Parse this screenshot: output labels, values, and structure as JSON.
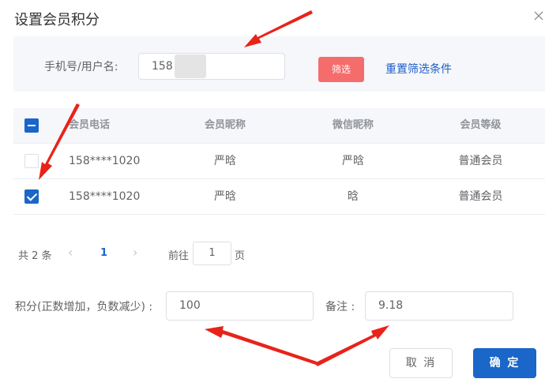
{
  "dialog": {
    "title": "设置会员积分",
    "close_icon": "close-icon"
  },
  "filter": {
    "label": "手机号/用户名:",
    "input_value": "158      1020",
    "filter_button": "筛选",
    "reset_link": "重置筛选条件"
  },
  "table": {
    "headers": [
      "会员电话",
      "会员昵称",
      "微信昵称",
      "会员等级"
    ],
    "rows": [
      {
        "checked": false,
        "phone": "158****1020",
        "nickname": "严晗",
        "wechat": "严晗",
        "level": "普通会员"
      },
      {
        "checked": true,
        "phone": "158****1020",
        "nickname": "严晗",
        "wechat": "晗",
        "level": "普通会员"
      }
    ]
  },
  "pagination": {
    "total": "共 2 条",
    "prev_icon": "chevron-left-icon",
    "current_page": "1",
    "next_icon": "chevron-right-icon",
    "goto_label": "前往",
    "goto_value": "1",
    "goto_unit": "页"
  },
  "form": {
    "points_label": "积分(正数增加，负数减少) :",
    "points_value": "100",
    "remark_label": "备注 :",
    "remark_value": "9.18"
  },
  "buttons": {
    "cancel": "取 消",
    "confirm": "确 定"
  },
  "colors": {
    "primary": "#1a66c9",
    "danger": "#f56c6c",
    "link": "#1e5fc8",
    "annotation_arrow": "#e8231a"
  }
}
